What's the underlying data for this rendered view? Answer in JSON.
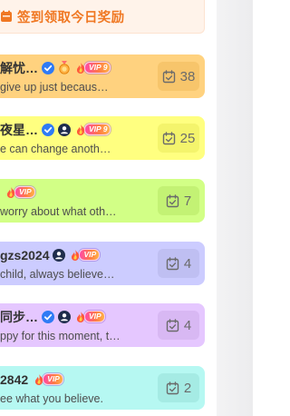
{
  "banner": {
    "text": "签到领取今日奖励",
    "icon": "checkin-gift-icon",
    "color": "#f07823"
  },
  "cards": [
    {
      "name": "解忧…",
      "message": "give up just becaus…",
      "badges": [
        "verified-icon",
        "medal-icon"
      ],
      "vip": "VIP",
      "vip_level": "9",
      "count": "38",
      "background": "#ffd27f",
      "count_bg": "#f7c56b"
    },
    {
      "name": "夜星…",
      "message": "e can change anoth…",
      "badges": [
        "verified-icon",
        "user-icon"
      ],
      "vip": "VIP",
      "vip_level": "9",
      "count": "25",
      "background": "#ffff80",
      "count_bg": "#f4f46c"
    },
    {
      "name": "",
      "message": "worry about what oth…",
      "badges": [],
      "vip": "VIP",
      "vip_level": "",
      "count": "7",
      "background": "#d2ff86",
      "count_bg": "#c3f274"
    },
    {
      "name": "gzs2024",
      "message": "child, always believe…",
      "badges": [
        "user-icon"
      ],
      "vip": "VIP",
      "vip_level": "",
      "count": "4",
      "background": "#ccccff",
      "count_bg": "#bfbff2"
    },
    {
      "name": "同步…",
      "message": "ppy for this moment, t…",
      "badges": [
        "verified-icon",
        "user-icon"
      ],
      "vip": "VIP",
      "vip_level": "",
      "count": "4",
      "background": "#e5c7ff",
      "count_bg": "#d8b8f3"
    },
    {
      "name": "2842",
      "message": "ee what you believe.",
      "badges": [],
      "vip": "VIP",
      "vip_level": "",
      "count": "2",
      "background": "#b6f8f2",
      "count_bg": "#a5ebe4"
    }
  ],
  "count_icon": "calendar-check-icon"
}
